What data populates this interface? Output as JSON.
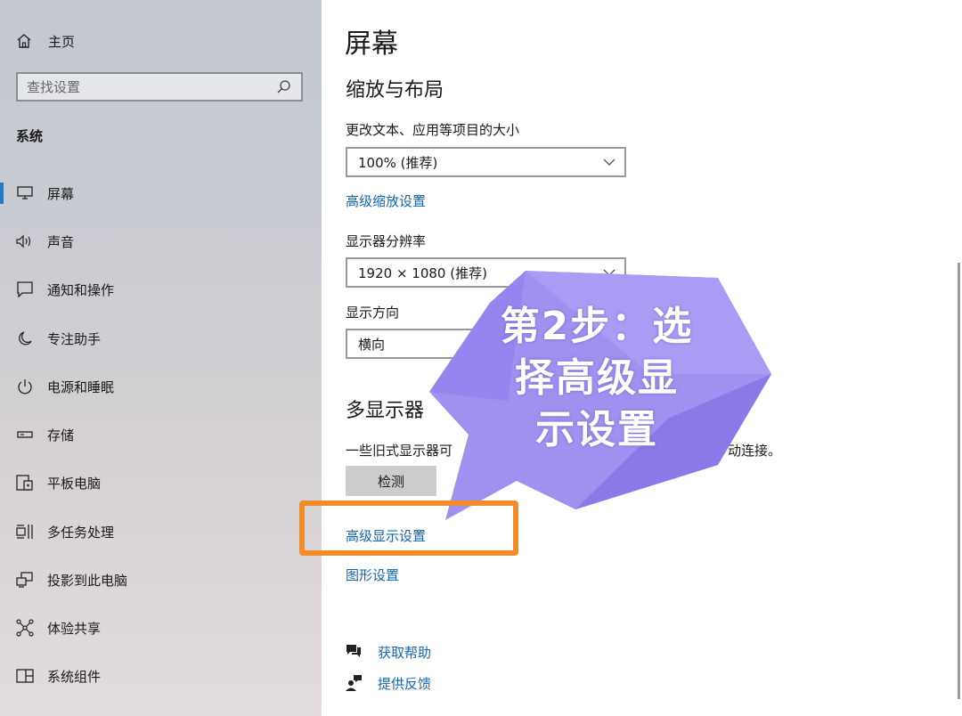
{
  "sidebar": {
    "home_label": "主页",
    "search_placeholder": "查找设置",
    "section_title": "系统",
    "items": [
      {
        "label": "屏幕",
        "icon": "monitor-icon",
        "active": true
      },
      {
        "label": "声音",
        "icon": "speaker-icon"
      },
      {
        "label": "通知和操作",
        "icon": "notification-icon"
      },
      {
        "label": "专注助手",
        "icon": "moon-icon"
      },
      {
        "label": "电源和睡眠",
        "icon": "power-icon"
      },
      {
        "label": "存储",
        "icon": "storage-icon"
      },
      {
        "label": "平板电脑",
        "icon": "tablet-icon"
      },
      {
        "label": "多任务处理",
        "icon": "multitask-icon"
      },
      {
        "label": "投影到此电脑",
        "icon": "project-icon"
      },
      {
        "label": "体验共享",
        "icon": "share-icon"
      },
      {
        "label": "系统组件",
        "icon": "components-icon"
      }
    ]
  },
  "main": {
    "page_title": "屏幕",
    "scale_section": {
      "heading": "缩放与布局",
      "text_size_label": "更改文本、应用等项目的大小",
      "text_size_value": "100% (推荐)",
      "advanced_scaling_link": "高级缩放设置",
      "resolution_label": "显示器分辨率",
      "resolution_value": "1920 × 1080 (推荐)",
      "orientation_label": "显示方向",
      "orientation_value": "横向"
    },
    "multi_display": {
      "heading": "多显示器",
      "description_left": "一些旧式显示器可",
      "description_right": "动连接。",
      "detect_button": "检测",
      "advanced_display_link": "高级显示设置",
      "graphics_link": "图形设置"
    },
    "help": {
      "get_help": "获取帮助",
      "feedback": "提供反馈"
    }
  },
  "overlay": {
    "callout_lines": [
      "第2步：选",
      "择高级显",
      "示设置"
    ],
    "callout_color": "#9d8cf0",
    "highlight_color": "#f28c2a"
  },
  "colors": {
    "accent": "#1f7ac8",
    "link": "#1565b0"
  }
}
